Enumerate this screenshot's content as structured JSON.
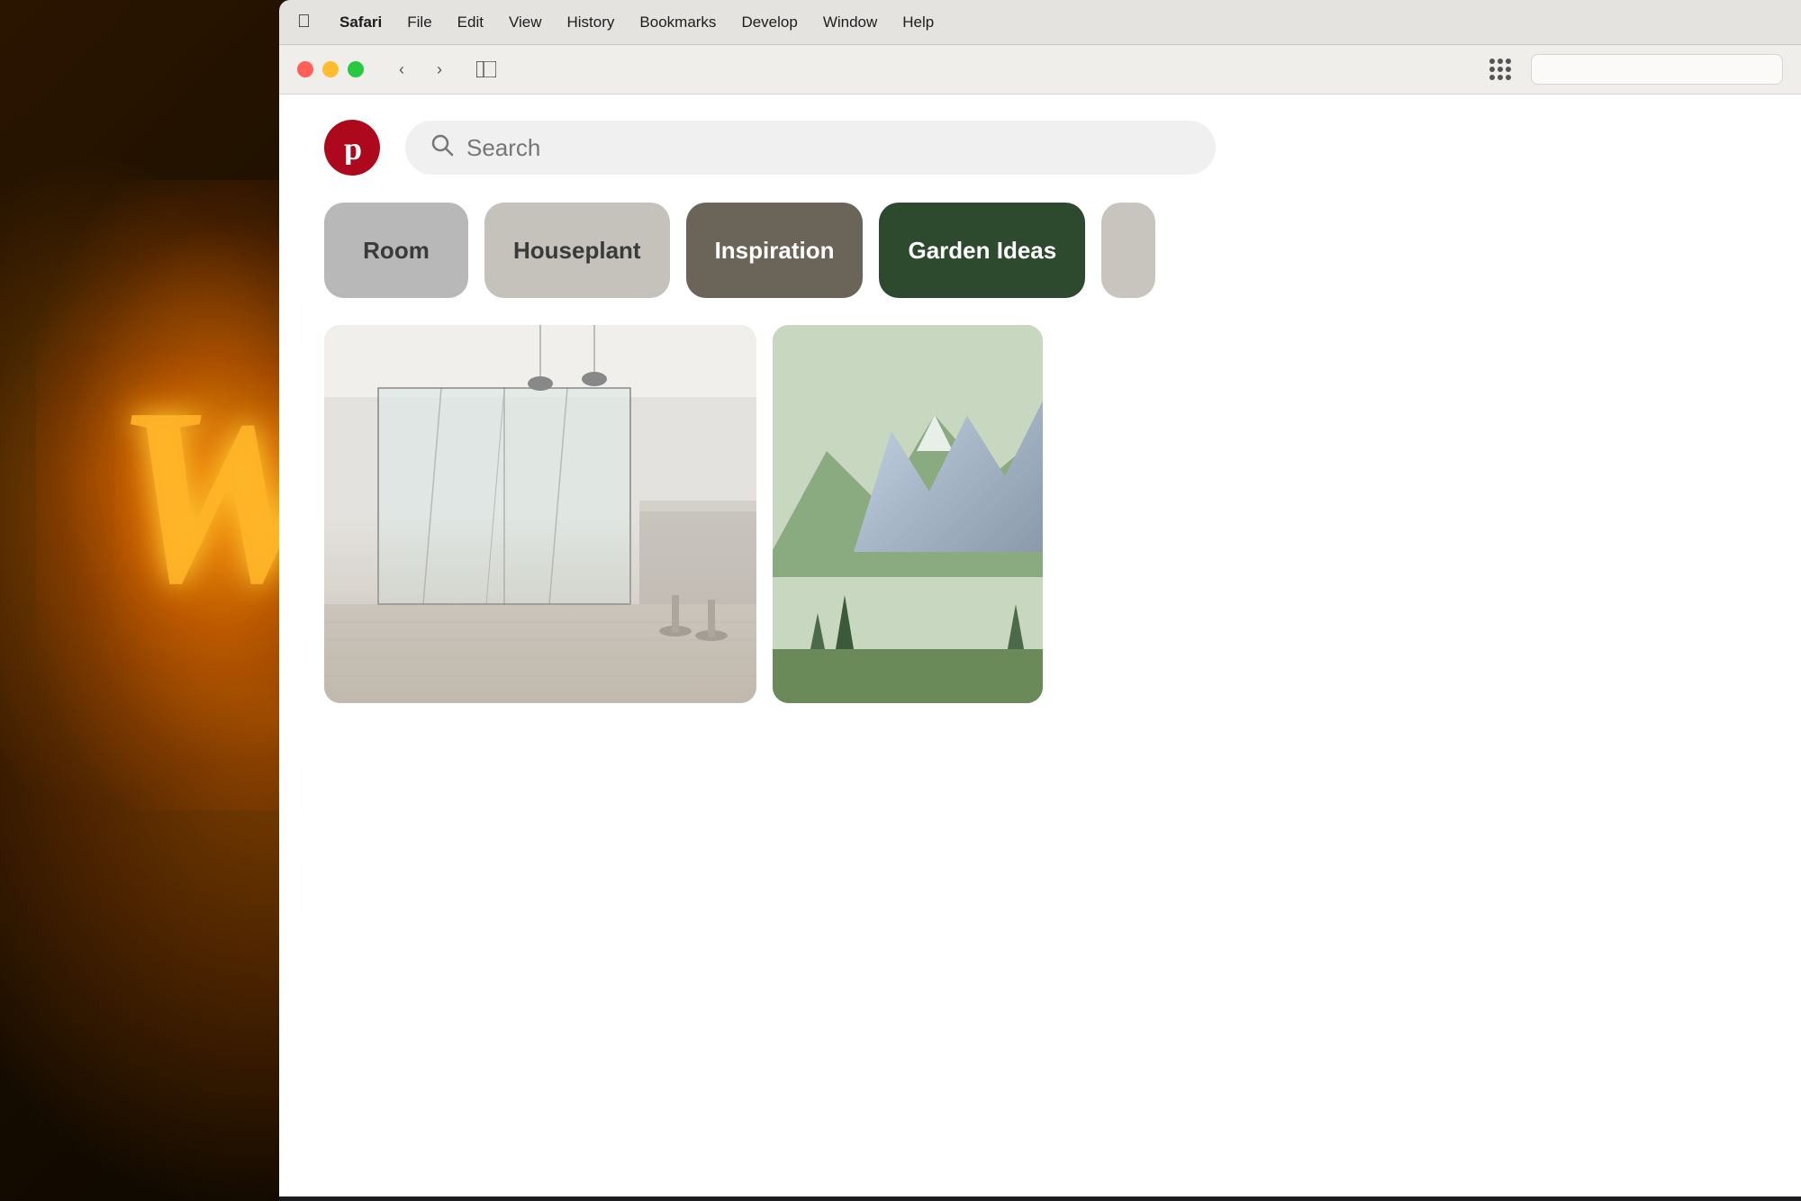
{
  "background": {
    "letter": "W"
  },
  "menubar": {
    "apple": "⌘",
    "safari": "Safari",
    "items": [
      "File",
      "Edit",
      "View",
      "History",
      "Bookmarks",
      "Develop",
      "Window",
      "Help"
    ]
  },
  "browser": {
    "back_label": "‹",
    "forward_label": "›",
    "traffic_lights": [
      "red",
      "yellow",
      "green"
    ]
  },
  "pinterest": {
    "logo_letter": "p",
    "search_placeholder": "Search",
    "categories": [
      {
        "label": "Room",
        "style": "light-gray"
      },
      {
        "label": "Houseplant",
        "style": "medium-gray"
      },
      {
        "label": "Inspiration",
        "style": "dark-gray"
      },
      {
        "label": "Garden Ideas",
        "style": "dark-green"
      }
    ]
  }
}
